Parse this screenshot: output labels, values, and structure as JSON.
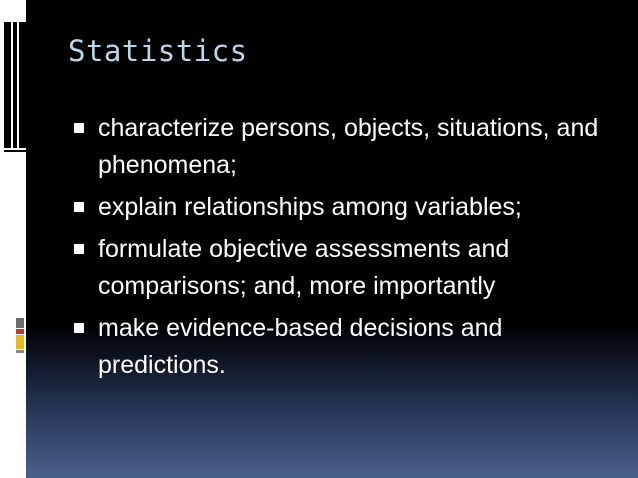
{
  "slide": {
    "title": "Statistics",
    "bullets": [
      "characterize persons, objects, situations, and phenomena;",
      "explain relationships among variables;",
      "formulate objective assessments and comparisons; and, more importantly",
      "make evidence-based decisions and predictions."
    ]
  },
  "colors": {
    "title": "#b8d7ea",
    "text": "#ffffff",
    "accent_yellow": "#e8b923",
    "accent_gray": "#6d6d6d",
    "accent_red": "#c0392b"
  },
  "icons": {
    "bullet": "square-bullet-icon"
  }
}
